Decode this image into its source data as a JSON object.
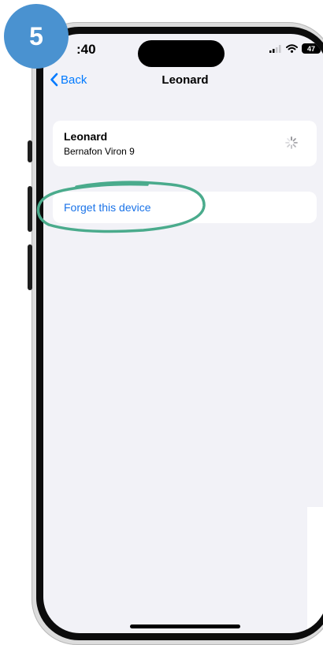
{
  "step": {
    "number": "5"
  },
  "status_bar": {
    "time": ":40",
    "battery": "47"
  },
  "nav": {
    "back_label": "Back",
    "title": "Leonard"
  },
  "device": {
    "name": "Leonard",
    "model": "Bernafon Viron 9"
  },
  "actions": {
    "forget_label": "Forget this device"
  },
  "colors": {
    "accent": "#007aff",
    "link": "#1a73e8",
    "highlight": "#4aab8c",
    "badge": "#4a92d0",
    "background": "#f2f2f7"
  }
}
